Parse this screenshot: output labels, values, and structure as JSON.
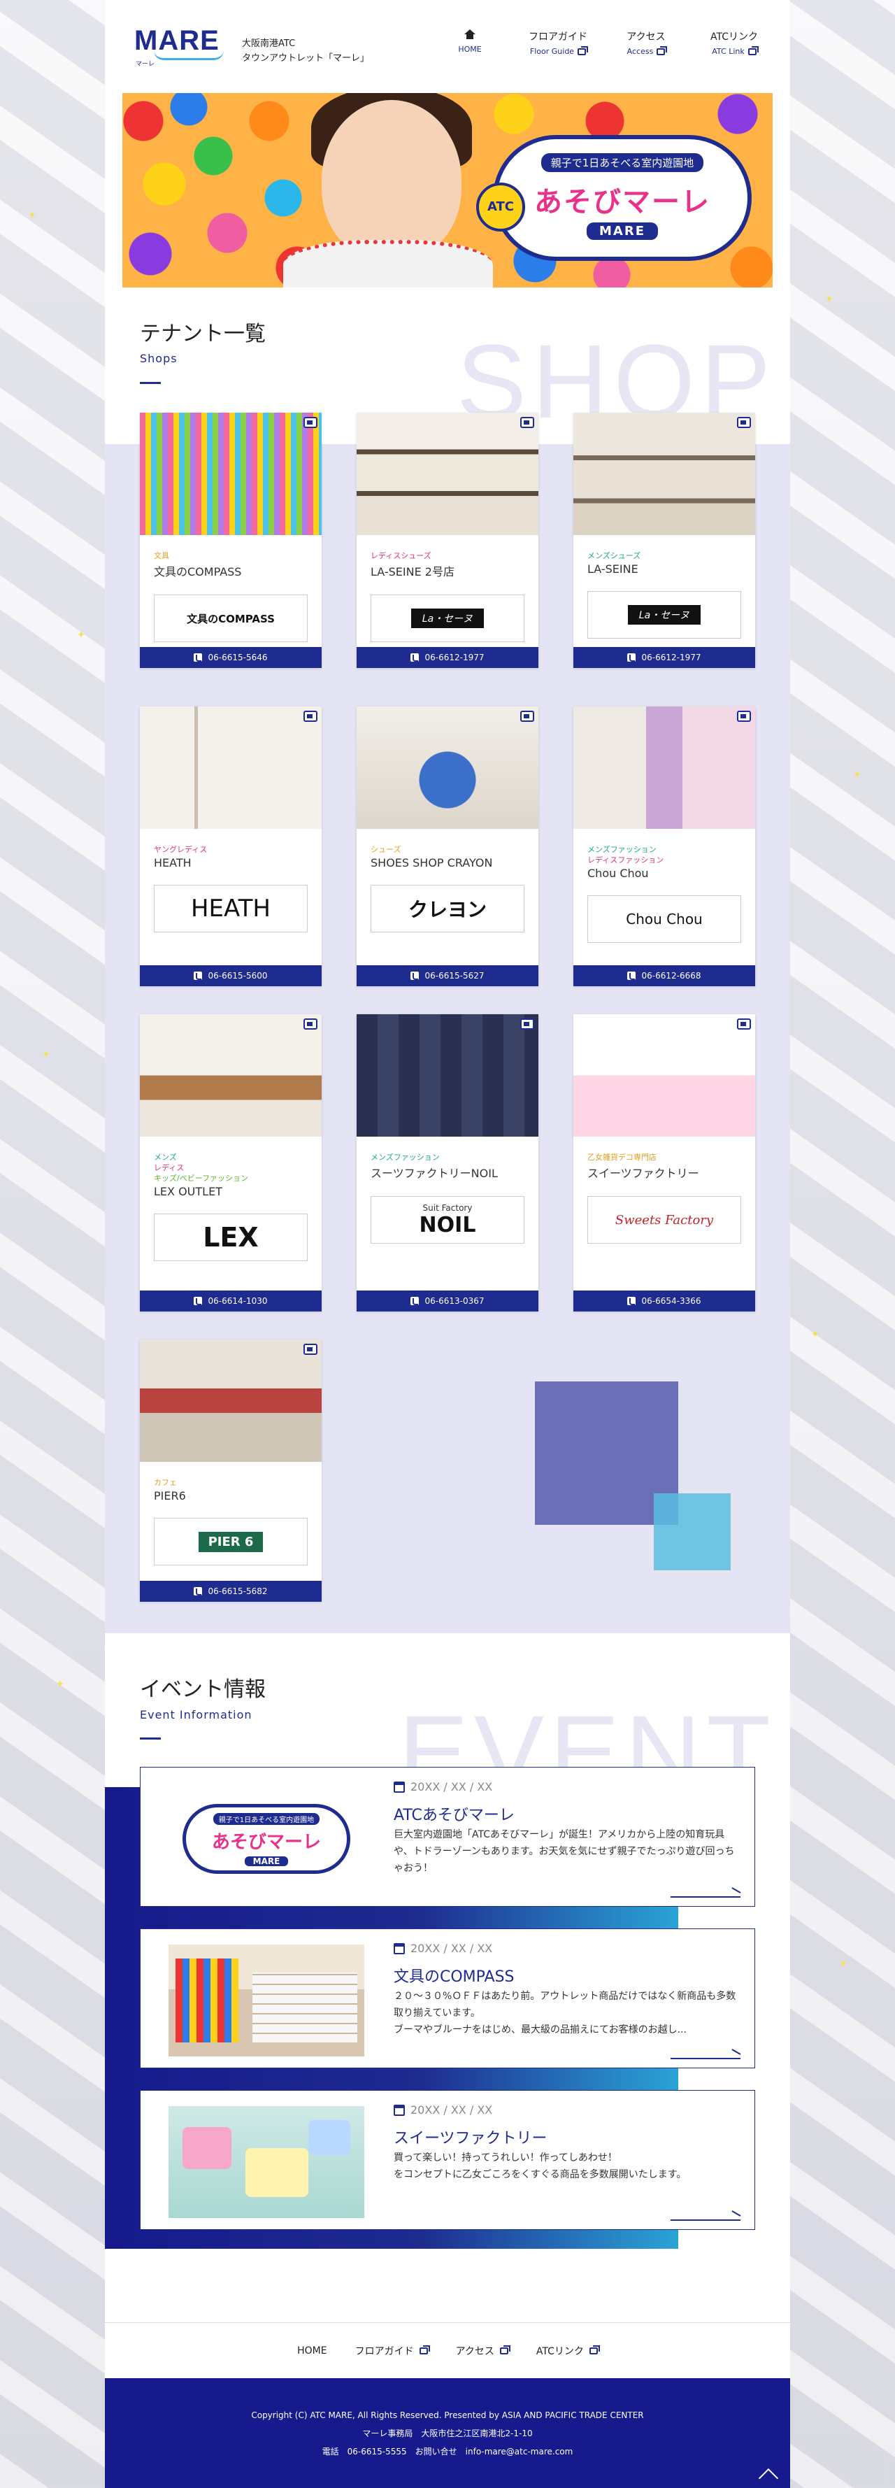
{
  "site": {
    "logo": "MARE",
    "logo_kana": "マーレ",
    "tagline_line1": "大阪南港ATC",
    "tagline_line2": "タウンアウトレット「マーレ」"
  },
  "nav": [
    {
      "jp": "",
      "en": "HOME",
      "icon": "home-icon"
    },
    {
      "jp": "フロアガイド",
      "en": "Floor Guide",
      "icon": "external-link-icon"
    },
    {
      "jp": "アクセス",
      "en": "Access",
      "icon": "external-link-icon"
    },
    {
      "jp": "ATCリンク",
      "en": "ATC Link",
      "icon": "external-link-icon"
    }
  ],
  "hero": {
    "sub": "親子で1日あそべる室内遊園地",
    "atc": "ATC",
    "main": "あそびマーレ",
    "en": "MARE"
  },
  "shops_section": {
    "title": "テナント一覧",
    "subtitle": "Shops",
    "bg_word": "SHOP"
  },
  "shops": [
    {
      "cats": [
        {
          "t": "文具",
          "c": "#e0a11a"
        }
      ],
      "name": "文具のCOMPASS",
      "logo": "文具のCOMPASS",
      "tel": "06-6615-5646"
    },
    {
      "cats": [
        {
          "t": "レディスシューズ",
          "c": "#e0317a"
        }
      ],
      "name": "LA-SEINE 2号店",
      "logo": "La・セーヌ",
      "tel": "06-6612-1977"
    },
    {
      "cats": [
        {
          "t": "メンズシューズ",
          "c": "#1aa58e"
        }
      ],
      "name": "LA-SEINE",
      "logo": "La・セーヌ",
      "tel": "06-6612-1977"
    },
    {
      "cats": [
        {
          "t": "ヤングレディス",
          "c": "#e0317a"
        }
      ],
      "name": "HEATH",
      "logo": "HEATH",
      "tel": "06-6615-5600"
    },
    {
      "cats": [
        {
          "t": "シューズ",
          "c": "#e0a11a"
        }
      ],
      "name": "SHOES SHOP CRAYON",
      "logo": "クレヨン",
      "tel": "06-6615-5627"
    },
    {
      "cats": [
        {
          "t": "メンズファッション",
          "c": "#1aa58e"
        },
        {
          "t": "レディスファッション",
          "c": "#e0317a"
        }
      ],
      "name": "Chou Chou",
      "logo": "Chou  Chou",
      "tel": "06-6612-6668"
    },
    {
      "cats": [
        {
          "t": "メンズ",
          "c": "#1aa58e"
        },
        {
          "t": "レディス",
          "c": "#e0317a"
        },
        {
          "t": "キッズ/ベビーファッション",
          "c": "#5bb52a"
        }
      ],
      "name": "LEX OUTLET",
      "logo": "LEX",
      "tel": "06-6614-1030"
    },
    {
      "cats": [
        {
          "t": "メンズファッション",
          "c": "#1aa58e"
        }
      ],
      "name": "スーツファクトリーNOIL",
      "logo": "NOIL",
      "logo_top": "Suit Factory",
      "tel": "06-6613-0367"
    },
    {
      "cats": [
        {
          "t": "乙女雑貨デコ専門店",
          "c": "#e0a11a"
        }
      ],
      "name": "スイーツファクトリー",
      "logo": "Sweets Factory",
      "tel": "06-6654-3366"
    },
    {
      "cats": [
        {
          "t": "カフェ",
          "c": "#e0a11a"
        }
      ],
      "name": "PIER6",
      "logo": "PIER 6",
      "tel": "06-6615-5682"
    }
  ],
  "events_section": {
    "title": "イベント情報",
    "subtitle": "Event Information",
    "bg_word": "EVENT"
  },
  "events": [
    {
      "date": "20XX / XX / XX",
      "title": "ATCあそびマーレ",
      "text": "巨大室内遊園地「ATCあそびマーレ」が誕生！アメリカから上陸の知育玩具や、トドラーゾーンもあります。お天気を気にせず親子でたっぷり遊び回っちゃおう！"
    },
    {
      "date": "20XX / XX / XX",
      "title": "文具のCOMPASS",
      "text": "２０～３０%ＯＦＦはあたり前。アウトレット商品だけではなく新商品も多数取り揃えています。\nブーマやブルーナをはじめ、最大級の品揃えにてお客様のお越し..."
    },
    {
      "date": "20XX / XX / XX",
      "title": "スイーツファクトリー",
      "text": "買って楽しい！持ってうれしい！作ってしあわせ！\nをコンセプトに乙女ごころをくすぐる商品を多数展開いたします。"
    }
  ],
  "footer": {
    "nav": [
      "HOME",
      "フロアガイド",
      "アクセス",
      "ATCリンク"
    ],
    "copyright": "Copyright (C) ATC MARE, All Rights Reserved. Presented by ASIA AND PACIFIC TRADE CENTER",
    "address": "マーレ事務局　大阪市住之江区南港北2-1-10",
    "contact": "電話　06-6615-5555　お問い合せ　info-mare@atc-mare.com"
  },
  "colors": {
    "brand": "#1e2b8f",
    "accent": "#3ab2e6"
  }
}
